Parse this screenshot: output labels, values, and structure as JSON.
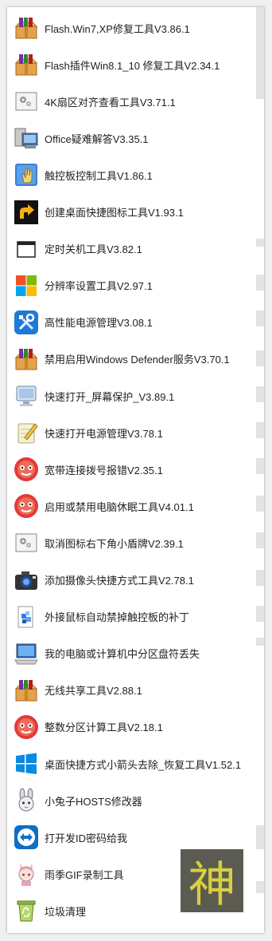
{
  "items": [
    {
      "label": "Flash.Win7,XP修复工具V3.86.1",
      "icon": "winrar-box-icon"
    },
    {
      "label": "Flash插件Win8.1_10 修复工具V2.34.1",
      "icon": "winrar-box-icon"
    },
    {
      "label": "4K扇区对齐查看工具V3.71.1",
      "icon": "gear-window-icon"
    },
    {
      "label": "Office疑难解答V3.35.1",
      "icon": "computer-help-icon"
    },
    {
      "label": "触控板控制工具V1.86.1",
      "icon": "hand-pointer-icon"
    },
    {
      "label": "创建桌面快捷图标工具V1.93.1",
      "icon": "shortcut-arrow-icon"
    },
    {
      "label": "定时关机工具V3.82.1",
      "icon": "window-outline-icon"
    },
    {
      "label": "分辨率设置工具V2.97.1",
      "icon": "windows-logo-icon"
    },
    {
      "label": "高性能电源管理V3.08.1",
      "icon": "tools-icon"
    },
    {
      "label": "禁用启用Windows Defender服务V3.70.1",
      "icon": "winrar-box-icon"
    },
    {
      "label": "快速打开_屏幕保护_V3.89.1",
      "icon": "monitor-icon"
    },
    {
      "label": "快速打开电源管理V3.78.1",
      "icon": "notepad-pencil-icon"
    },
    {
      "label": "宽带连接拨号报错V2.35.1",
      "icon": "red-face-icon"
    },
    {
      "label": "启用或禁用电脑休眠工具V4.01.1",
      "icon": "red-face-icon"
    },
    {
      "label": "取消图标右下角小盾牌V2.39.1",
      "icon": "gear-window-icon"
    },
    {
      "label": "添加摄像头快捷方式工具V2.78.1",
      "icon": "camera-icon"
    },
    {
      "label": "外接鼠标自动禁掉触控板的补丁",
      "icon": "cubes-icon"
    },
    {
      "label": "我的电脑或计算机中分区盘符丢失",
      "icon": "computer-drive-icon"
    },
    {
      "label": "无线共享工具V2.88.1",
      "icon": "winrar-box-icon"
    },
    {
      "label": "整数分区计算工具V2.18.1",
      "icon": "red-face-icon"
    },
    {
      "label": "桌面快捷方式小箭头去除_恢复工具V1.52.1",
      "icon": "windows10-logo-icon"
    },
    {
      "label": "小兔子HOSTS修改器",
      "icon": "rabbit-icon"
    },
    {
      "label": "打开发ID密码给我",
      "icon": "teamviewer-icon"
    },
    {
      "label": "雨季GIF录制工具",
      "icon": "anime-girl-icon"
    },
    {
      "label": "垃圾清理",
      "icon": "recycle-bin-icon"
    }
  ],
  "badge": {
    "text": "神"
  },
  "colors": {
    "accent": "#d8cf3f",
    "badge_bg": "#5b5b52"
  }
}
